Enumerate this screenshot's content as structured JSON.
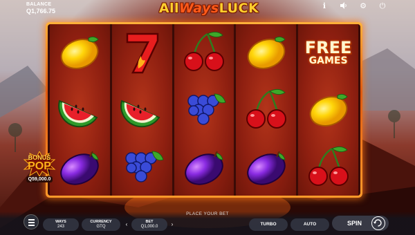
{
  "header": {
    "balance_label": "BALANCE",
    "balance_value": "Q1,766.75",
    "logo_prefix": "All",
    "logo_middle": "Ways",
    "logo_suffix": "LUCK"
  },
  "top_icons": [
    "info-icon",
    "sound-icon",
    "settings-icon",
    "fullscreen-icon"
  ],
  "reels": [
    [
      "lemon",
      "watermelon",
      "plum"
    ],
    [
      "seven",
      "watermelon",
      "grapes"
    ],
    [
      "cherries",
      "grapes",
      "plum"
    ],
    [
      "lemon",
      "cherries",
      "plum"
    ],
    [
      "free-games",
      "lemon",
      "cherries"
    ]
  ],
  "free_games": {
    "line1": "FREE",
    "line2": "GAMES"
  },
  "bonus_pop": {
    "line1": "BONUS",
    "line2": "POP",
    "amount": "Q59,000.0"
  },
  "footer": {
    "place_bet": "PLACE YOUR BET",
    "ways_label": "WAYS",
    "ways_value": "243",
    "currency_label": "CURRENCY",
    "currency_value": "GTQ",
    "bet_label": "BET",
    "bet_value": "Q1,000.0",
    "turbo_label": "TURBO",
    "auto_label": "AUTO",
    "spin_label": "SPIN"
  },
  "colors": {
    "frame": "#ff9a2a",
    "reel": "#9c2614",
    "logo": "#ffcf2e",
    "panel": "#32343f"
  }
}
